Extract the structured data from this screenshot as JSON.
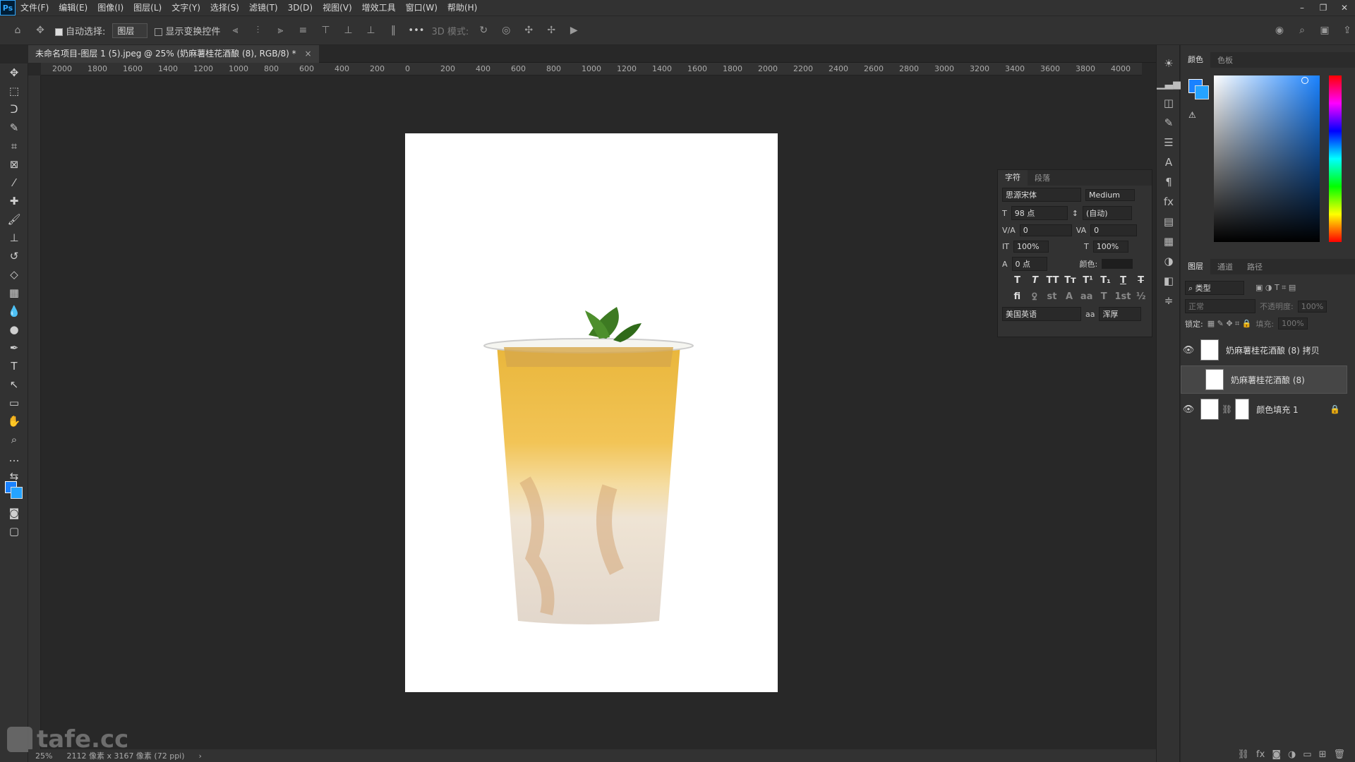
{
  "menu": {
    "logo": "Ps",
    "items": [
      "文件(F)",
      "编辑(E)",
      "图像(I)",
      "图层(L)",
      "文字(Y)",
      "选择(S)",
      "滤镜(T)",
      "3D(D)",
      "视图(V)",
      "增效工具",
      "窗口(W)",
      "帮助(H)"
    ]
  },
  "window_controls": {
    "minimize": "–",
    "restore": "❐",
    "close": "✕"
  },
  "options": {
    "auto_select_label": "自动选择:",
    "auto_select_value": "图层",
    "show_transform_label": "显示变换控件",
    "more": "•••",
    "mode_3d_label": "3D 模式:"
  },
  "document_tab": {
    "title": "未命名项目-图层 1 (5).jpeg @ 25% (奶麻薯桂花酒酿 (8), RGB/8) *",
    "close": "×"
  },
  "ruler": {
    "ticks": [
      "2000",
      "1800",
      "1600",
      "1400",
      "1200",
      "1000",
      "800",
      "600",
      "400",
      "200",
      "0",
      "200",
      "400",
      "600",
      "800",
      "1000",
      "1200",
      "1400",
      "1600",
      "1800",
      "2000",
      "2200",
      "2400",
      "2600",
      "2800",
      "3000",
      "3200",
      "3400",
      "3600",
      "3800",
      "4000"
    ]
  },
  "status": {
    "zoom": "25%",
    "doc_size": "2112 像素 x 3167 像素 (72 ppi)",
    "arrow": "›"
  },
  "watermark": "tafe.cc",
  "color_panel": {
    "tabs": [
      "颜色",
      "色板"
    ],
    "active": 0
  },
  "character_panel": {
    "tabs": [
      "字符",
      "段落"
    ],
    "font_family": "思源宋体",
    "font_style": "Medium",
    "font_size": "98 点",
    "leading": "(自动)",
    "kerning": "0",
    "tracking": "0",
    "vscale": "100%",
    "hscale": "100%",
    "baseline": "0 点",
    "color_label": "颜色:",
    "language": "美国英语",
    "aa_label": "aa",
    "antialias": "浑厚",
    "style_buttons": [
      "T",
      "T",
      "TT",
      "Tт",
      "T¹",
      "T₁",
      "T",
      "T"
    ],
    "ot_buttons": [
      "fi",
      "ꝿ",
      "st",
      "A",
      "aa",
      "T",
      "1st",
      "½"
    ]
  },
  "layers_panel": {
    "tabs": [
      "图层",
      "通道",
      "路径"
    ],
    "filter_label": "类型",
    "blend_mode": "正常",
    "opacity_label": "不透明度:",
    "opacity": "100%",
    "lock_label": "锁定:",
    "fill_label": "填充:",
    "fill": "100%",
    "layers": [
      {
        "name": "奶麻薯桂花酒酿 (8) 拷贝",
        "visible": true
      },
      {
        "name": "奶麻薯桂花酒酿 (8)",
        "visible": false
      },
      {
        "name": "颜色填充 1",
        "visible": true
      }
    ],
    "footer_icons": [
      "link-icon",
      "fx-icon",
      "mask-icon",
      "adjustment-icon",
      "folder-icon",
      "new-layer-icon",
      "trash-icon"
    ]
  }
}
